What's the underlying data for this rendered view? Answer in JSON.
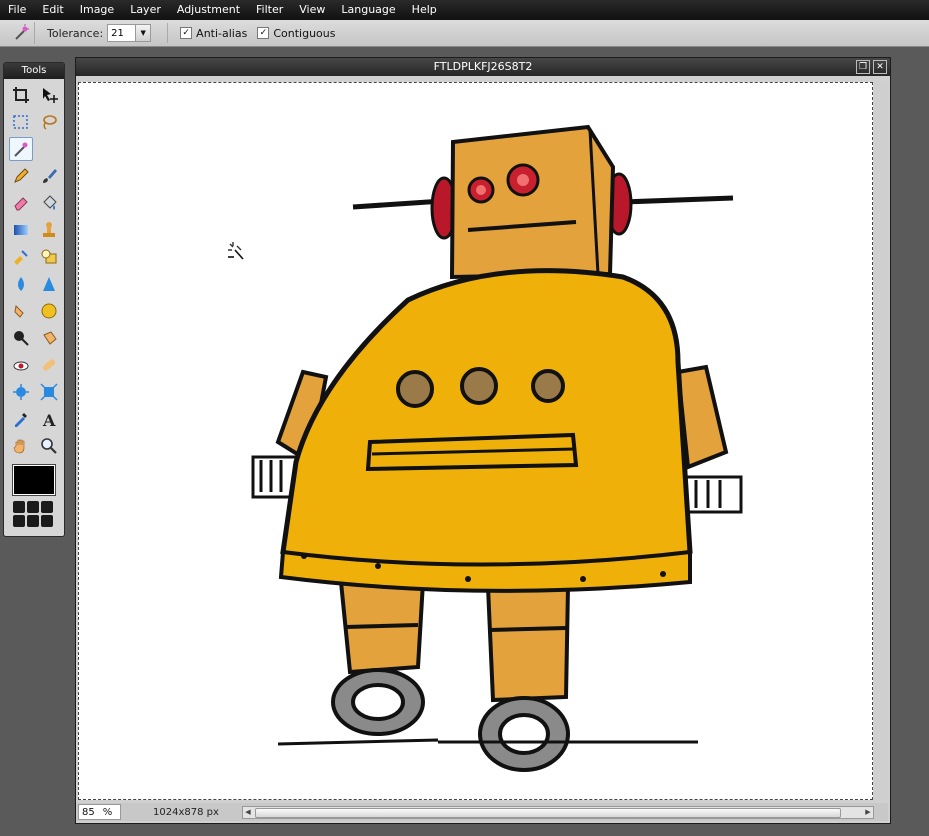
{
  "menu": [
    "File",
    "Edit",
    "Image",
    "Layer",
    "Adjustment",
    "Filter",
    "View",
    "Language",
    "Help"
  ],
  "options": {
    "tolerance_label": "Tolerance:",
    "tolerance_value": "21",
    "antialias_label": "Anti-alias",
    "contiguous_label": "Contiguous",
    "antialias_checked": "✓",
    "contiguous_checked": "✓"
  },
  "tools_panel": {
    "title": "Tools"
  },
  "document": {
    "title": "FTLDPLKFJ26S8T2",
    "restore_glyph": "❐",
    "close_glyph": "✕"
  },
  "status": {
    "zoom": "85",
    "zoom_unit": "%",
    "dimensions": "1024x878 px"
  },
  "colors": {
    "primary": "#000000",
    "robot_body": "#f0b00a",
    "robot_head": "#e3a23c",
    "robot_ears": "#b8182a"
  }
}
